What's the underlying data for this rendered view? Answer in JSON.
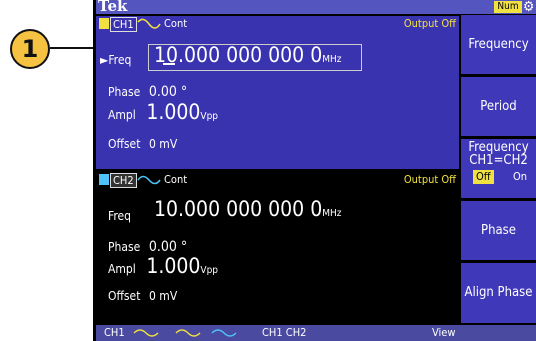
{
  "brand": "Tek",
  "status": {
    "mode": "Num"
  },
  "callout": "1",
  "ch1": {
    "label": "CH1",
    "mode": "Cont",
    "output": "Output Off",
    "freq_label": "Freq",
    "freq_value": "10.000 000 000 0",
    "freq_unit": "MHz",
    "phase_label": "Phase",
    "phase_value": "0.00 °",
    "ampl_label": "Ampl",
    "ampl_value": "1.000",
    "ampl_unit": "Vpp",
    "offset_label": "Offset",
    "offset_value": "0 mV"
  },
  "ch2": {
    "label": "CH2",
    "mode": "Cont",
    "output": "Output Off",
    "freq_label": "Freq",
    "freq_value": "10.000 000 000 0",
    "freq_unit": "MHz",
    "phase_label": "Phase",
    "phase_value": "0.00 °",
    "ampl_label": "Ampl",
    "ampl_value": "1.000",
    "ampl_unit": "Vpp",
    "offset_label": "Offset",
    "offset_value": "0 mV"
  },
  "menu": {
    "frequency": "Frequency",
    "period": "Period",
    "freq_link_line1": "Frequency",
    "freq_link_line2": "CH1=CH2",
    "off": "Off",
    "on": "On",
    "phase": "Phase",
    "align_phase": "Align Phase"
  },
  "bottom": {
    "ch1": "CH1",
    "ch1ch2": "CH1  CH2",
    "view": "View"
  },
  "colors": {
    "ch1": "#f0e040",
    "ch2": "#4fc3f7",
    "panel": "#3a33b0",
    "accent": "#f0e040"
  }
}
